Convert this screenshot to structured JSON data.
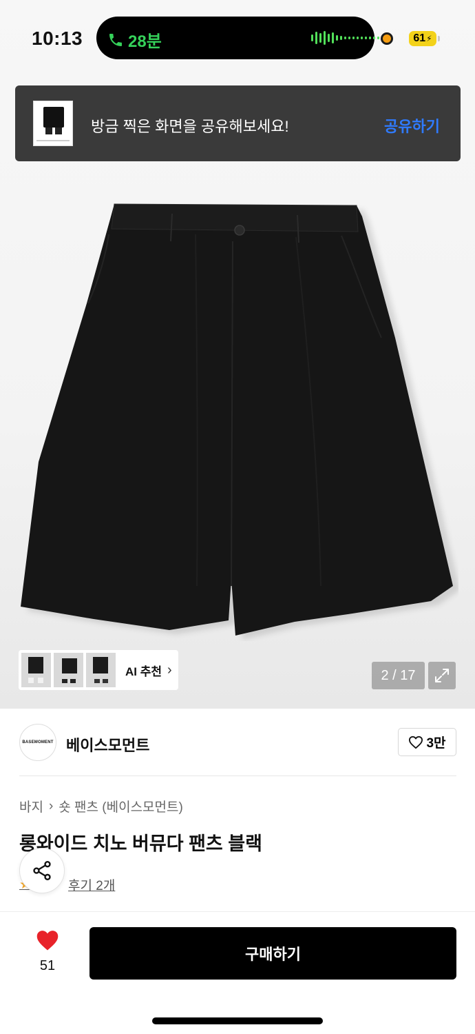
{
  "status_bar": {
    "time": "10:13",
    "call_duration": "28분",
    "battery": "61"
  },
  "share_toast": {
    "message": "방금 찍은 화면을 공유해보세요!",
    "action": "공유하기"
  },
  "gallery": {
    "counter": "2 / 17",
    "ai_recommend_label": "AI 추천"
  },
  "brand": {
    "logo_text": "BASEMOMENT",
    "name": "베이스모먼트",
    "likes": "3만"
  },
  "product": {
    "breadcrumb_category": "바지",
    "breadcrumb_subcategory": "숏 팬츠 (베이스모먼트)",
    "title": "롱와이드 치노 버뮤다 팬츠 블랙",
    "review": "후기 2개"
  },
  "bottom_bar": {
    "wish_count": "51",
    "buy_label": "구매하기"
  },
  "colors": {
    "call_green": "#35d15a",
    "toast_action_blue": "#2f7bff",
    "heart_red": "#e8232a",
    "battery_yellow": "#f3d21a"
  }
}
